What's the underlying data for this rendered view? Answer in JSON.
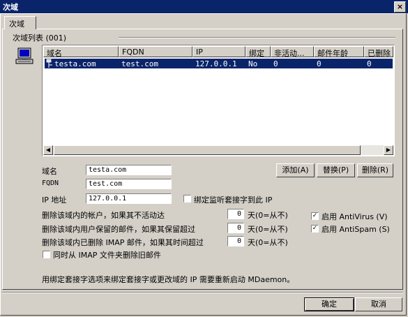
{
  "window": {
    "title": "次域",
    "close_glyph": "×"
  },
  "tabs": [
    {
      "label": "次域"
    }
  ],
  "group": {
    "label": "次域列表 (001)"
  },
  "list": {
    "columns": [
      "域名",
      "FQDN",
      "IP",
      "绑定",
      "非活动...",
      "邮件年龄",
      "已删除"
    ],
    "rows": [
      {
        "domain": "testa.com",
        "fqdn": "test.com",
        "ip": "127.0.0.1",
        "bind": "No",
        "inactive": "0",
        "mail_age": "0",
        "deleted": "0"
      }
    ]
  },
  "form": {
    "domain_label": "域名",
    "domain_value": "testa.com",
    "fqdn_label": "FQDN",
    "fqdn_value": "test.com",
    "ip_label": "IP 地址",
    "ip_value": "127.0.0.1",
    "bind_label": "绑定监听套接字到此 IP",
    "bind_checked": false
  },
  "buttons": {
    "add": "添加(A)",
    "replace": "替换(P)",
    "remove": "删除(R)",
    "ok": "确定",
    "cancel": "取消"
  },
  "settings": [
    {
      "label": "删除该域内的帐户，如果其不活动达",
      "value": "0",
      "unit": "天(0=从不)"
    },
    {
      "label": "删除该域内用户保留的邮件，如果其保留超过",
      "value": "0",
      "unit": "天(0=从不)"
    },
    {
      "label": "删除该域内已删除 IMAP 邮件，如果其时间超过",
      "value": "0",
      "unit": "天(0=从不)"
    }
  ],
  "imap_purge": {
    "label": "同时从 IMAP 文件夹删除旧邮件",
    "checked": false
  },
  "antivirus": {
    "label": "启用 AntiVirus (V)",
    "checked": true
  },
  "antispam": {
    "label": "启用 AntiSpam (S)",
    "checked": true
  },
  "note": "用绑定套接字选项来绑定套接字或更改域的 IP 需要重新启动 MDaemon。",
  "icons": {
    "domain_list": "computer-icon",
    "row": "domain-icon"
  },
  "colors": {
    "titlebar": "#0a246a",
    "face": "#d4d0c8",
    "selection": "#0a246a"
  }
}
